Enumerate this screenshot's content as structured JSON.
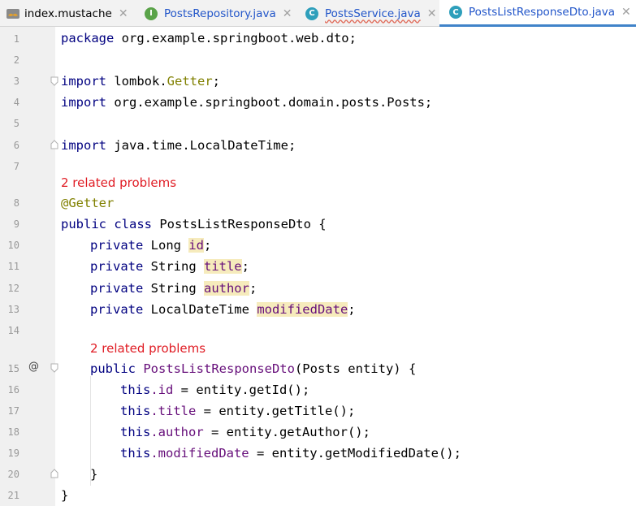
{
  "tabs": [
    {
      "label": "index.mustache",
      "icon": "mustache-icon",
      "closable": true
    },
    {
      "label": "PostsRepository.java",
      "icon": "interface-icon",
      "icon_letter": "I",
      "closable": true
    },
    {
      "label": "PostsService.java",
      "icon": "class-icon",
      "icon_letter": "C",
      "closable": true
    },
    {
      "label": "PostsListResponseDto.java",
      "icon": "class-icon",
      "icon_letter": "C",
      "closable": true,
      "active": true
    }
  ],
  "colors": {
    "keyword": "#000080",
    "annotation": "#808000",
    "field": "#660e7a",
    "highlight": "#f6ebbc",
    "problem_hint": "#e01c24",
    "interface_icon": "#5aa349",
    "class_icon": "#2e9fbb",
    "active_tab_underline": "#4083c9"
  },
  "editor": {
    "line_numbers": [
      "1",
      "2",
      "3",
      "4",
      "5",
      "6",
      "7",
      "8",
      "9",
      "10",
      "11",
      "12",
      "13",
      "14",
      "15",
      "16",
      "17",
      "18",
      "19",
      "20",
      "21"
    ],
    "hints": [
      "2 related problems",
      "2 related problems"
    ],
    "gutter_marker": "@",
    "code": {
      "l1_kw": "package",
      "l1_rest": " org.example.springboot.web.dto;",
      "l3_kw": "import",
      "l3_pkg": " lombok.",
      "l3_ann": "Getter",
      "l3_end": ";",
      "l4_kw": "import",
      "l4_rest": " org.example.springboot.domain.posts.Posts;",
      "l6_kw": "import",
      "l6_rest": " java.time.LocalDateTime;",
      "l8": "@Getter",
      "l9_kw": "public class",
      "l9_rest": " PostsListResponseDto {",
      "l10_kw": "private",
      "l10_type": " Long ",
      "l10_field": "id",
      "l10_end": ";",
      "l11_kw": "private",
      "l11_type": " String ",
      "l11_field": "title",
      "l11_end": ";",
      "l12_kw": "private",
      "l12_type": " String ",
      "l12_field": "author",
      "l12_end": ";",
      "l13_kw": "private",
      "l13_type": " LocalDateTime ",
      "l13_field": "modifiedDate",
      "l13_end": ";",
      "l15_kw": "public",
      "l15_name": " PostsListResponseDto",
      "l15_rest": "(Posts entity) {",
      "l16_kw": "this",
      "l16_field": ".id",
      "l16_rest": " = entity.getId();",
      "l17_kw": "this",
      "l17_field": ".title",
      "l17_rest": " = entity.getTitle();",
      "l18_kw": "this",
      "l18_field": ".author",
      "l18_rest": " = entity.getAuthor();",
      "l19_kw": "this",
      "l19_field": ".modifiedDate",
      "l19_rest": " = entity.getModifiedDate();",
      "l20": "}",
      "l21": "}"
    }
  }
}
